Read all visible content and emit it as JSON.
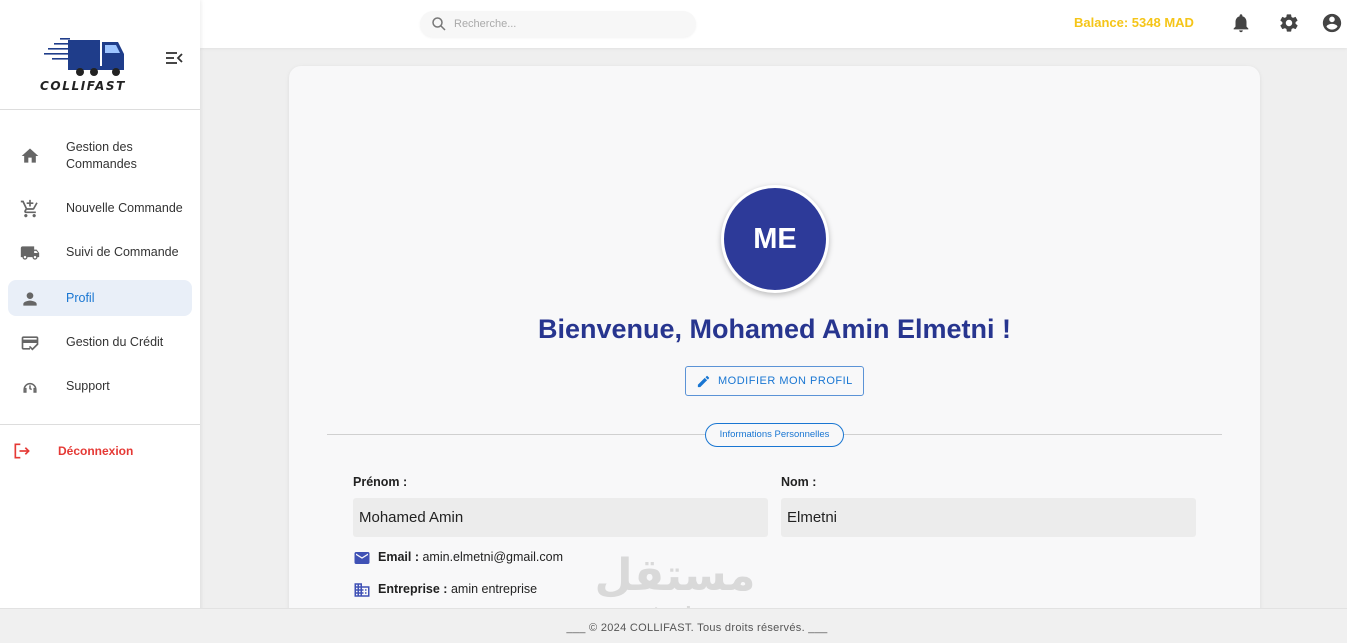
{
  "brand": {
    "name": "COLLIFAST"
  },
  "sidebar": {
    "items": [
      {
        "label": "Gestion des Commandes",
        "icon": "home-icon",
        "active": false
      },
      {
        "label": "Nouvelle Commande",
        "icon": "cart-add-icon",
        "active": false
      },
      {
        "label": "Suivi de Commande",
        "icon": "truck-icon",
        "active": false
      },
      {
        "label": "Profil",
        "icon": "person-icon",
        "active": true
      },
      {
        "label": "Gestion du Crédit",
        "icon": "credit-card-icon",
        "active": false
      },
      {
        "label": "Support",
        "icon": "support-icon",
        "active": false
      }
    ],
    "logout_label": "Déconnexion"
  },
  "topbar": {
    "search_placeholder": "Recherche...",
    "balance": "Balance: 5348 MAD"
  },
  "profile": {
    "initials": "ME",
    "welcome": "Bienvenue, Mohamed Amin Elmetni !",
    "edit_button": "MODIFIER MON PROFIL",
    "section_label": "Informations Personnelles",
    "first_name_label": "Prénom :",
    "first_name": "Mohamed Amin",
    "last_name_label": "Nom :",
    "last_name": "Elmetni",
    "email_label": "Email :",
    "email": "amin.elmetni@gmail.com",
    "company_label": "Entreprise :",
    "company": "amin entreprise"
  },
  "watermark": {
    "arabic": "مستقل",
    "latin": "mostaql.com"
  },
  "footer": {
    "text": "___  © 2024 COLLIFAST. Tous droits réservés.  ___"
  },
  "colors": {
    "primary": "#1976d2",
    "welcome": "#27358f",
    "avatar": "#2d3a99",
    "balance": "#f5c518",
    "logout": "#e53935",
    "active_bg": "#e9eff8"
  }
}
